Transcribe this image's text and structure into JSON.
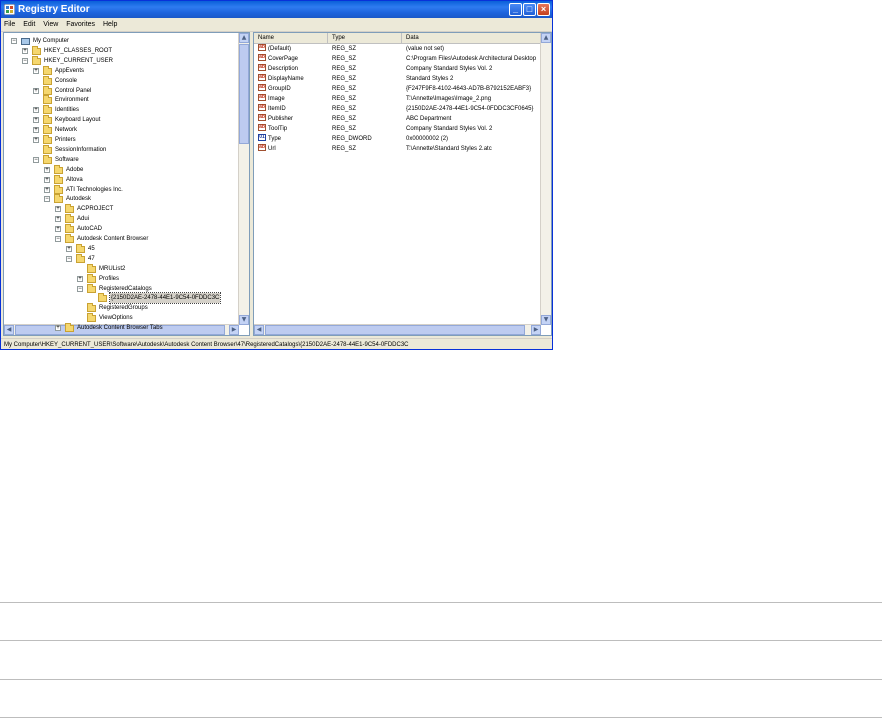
{
  "window": {
    "title": "Registry Editor"
  },
  "menu": [
    "File",
    "Edit",
    "View",
    "Favorites",
    "Help"
  ],
  "tree": [
    {
      "label": "My Computer",
      "indent": 0,
      "expander": "-",
      "icon": "computer"
    },
    {
      "label": "HKEY_CLASSES_ROOT",
      "indent": 1,
      "expander": "+",
      "icon": "folder"
    },
    {
      "label": "HKEY_CURRENT_USER",
      "indent": 1,
      "expander": "-",
      "icon": "folder"
    },
    {
      "label": "AppEvents",
      "indent": 2,
      "expander": "+",
      "icon": "folder"
    },
    {
      "label": "Console",
      "indent": 2,
      "expander": "",
      "icon": "folder"
    },
    {
      "label": "Control Panel",
      "indent": 2,
      "expander": "+",
      "icon": "folder"
    },
    {
      "label": "Environment",
      "indent": 2,
      "expander": "",
      "icon": "folder"
    },
    {
      "label": "Identities",
      "indent": 2,
      "expander": "+",
      "icon": "folder"
    },
    {
      "label": "Keyboard Layout",
      "indent": 2,
      "expander": "+",
      "icon": "folder"
    },
    {
      "label": "Network",
      "indent": 2,
      "expander": "+",
      "icon": "folder"
    },
    {
      "label": "Printers",
      "indent": 2,
      "expander": "+",
      "icon": "folder"
    },
    {
      "label": "SessionInformation",
      "indent": 2,
      "expander": "",
      "icon": "folder"
    },
    {
      "label": "Software",
      "indent": 2,
      "expander": "-",
      "icon": "folder"
    },
    {
      "label": "Adobe",
      "indent": 3,
      "expander": "+",
      "icon": "folder"
    },
    {
      "label": "Altova",
      "indent": 3,
      "expander": "+",
      "icon": "folder"
    },
    {
      "label": "ATI Technologies Inc.",
      "indent": 3,
      "expander": "+",
      "icon": "folder"
    },
    {
      "label": "Autodesk",
      "indent": 3,
      "expander": "-",
      "icon": "folder"
    },
    {
      "label": "ACPROJECT",
      "indent": 4,
      "expander": "+",
      "icon": "folder"
    },
    {
      "label": "Adui",
      "indent": 4,
      "expander": "+",
      "icon": "folder"
    },
    {
      "label": "AutoCAD",
      "indent": 4,
      "expander": "+",
      "icon": "folder"
    },
    {
      "label": "Autodesk Content Browser",
      "indent": 4,
      "expander": "-",
      "icon": "folder"
    },
    {
      "label": "45",
      "indent": 5,
      "expander": "+",
      "icon": "folder"
    },
    {
      "label": "47",
      "indent": 5,
      "expander": "-",
      "icon": "folder"
    },
    {
      "label": "MRUList2",
      "indent": 6,
      "expander": "",
      "icon": "folder"
    },
    {
      "label": "Profiles",
      "indent": 6,
      "expander": "+",
      "icon": "folder"
    },
    {
      "label": "RegisteredCatalogs",
      "indent": 6,
      "expander": "-",
      "icon": "folder"
    },
    {
      "label": "{2150D2AE-2478-44E1-9C54-0FDDC3C",
      "indent": 7,
      "expander": "",
      "icon": "folder",
      "selected": true
    },
    {
      "label": "RegisteredGroups",
      "indent": 6,
      "expander": "",
      "icon": "folder"
    },
    {
      "label": "ViewOptions",
      "indent": 6,
      "expander": "",
      "icon": "folder"
    },
    {
      "label": "Autodesk Content Browser Tabs",
      "indent": 4,
      "expander": "+",
      "icon": "folder"
    }
  ],
  "list": {
    "headers": [
      "Name",
      "Type",
      "Data"
    ],
    "rows": [
      {
        "name": "(Default)",
        "type": "REG_SZ",
        "data": "(value not set)",
        "icon": "ab"
      },
      {
        "name": "CoverPage",
        "type": "REG_SZ",
        "data": "C:\\Program Files\\Autodesk Architectural Desktop",
        "icon": "ab"
      },
      {
        "name": "Description",
        "type": "REG_SZ",
        "data": "Company Standard Styles Vol. 2",
        "icon": "ab"
      },
      {
        "name": "DisplayName",
        "type": "REG_SZ",
        "data": "Standard Styles 2",
        "icon": "ab"
      },
      {
        "name": "GroupID",
        "type": "REG_SZ",
        "data": "{F247F9F8-4102-4643-AD7B-B792152EABF3}",
        "icon": "ab"
      },
      {
        "name": "Image",
        "type": "REG_SZ",
        "data": "T:\\Annette\\Images\\Image_2.png",
        "icon": "ab"
      },
      {
        "name": "ItemID",
        "type": "REG_SZ",
        "data": "{2150D2AE-2478-44E1-9C54-0FDDC3CF0645}",
        "icon": "ab"
      },
      {
        "name": "Publisher",
        "type": "REG_SZ",
        "data": "ABC Department",
        "icon": "ab"
      },
      {
        "name": "ToolTip",
        "type": "REG_SZ",
        "data": "Company Standard Styles Vol. 2",
        "icon": "ab"
      },
      {
        "name": "Type",
        "type": "REG_DWORD",
        "data": "0x00000002 (2)",
        "icon": "dw"
      },
      {
        "name": "Url",
        "type": "REG_SZ",
        "data": "T:\\Annette\\Standard Styles 2.atc",
        "icon": "ab"
      }
    ]
  },
  "statusbar": "My Computer\\HKEY_CURRENT_USER\\Software\\Autodesk\\Autodesk Content Browser\\47\\RegisteredCatalogs\\{2150D2AE-2478-44E1-9C54-0FDDC3C",
  "colors": {
    "titlebar": "#1d63dc",
    "selection": "#d4d0c8"
  },
  "icons": {
    "app": "registry-editor-icon",
    "minimize": "minimize-icon",
    "maximize": "maximize-icon",
    "close": "close-icon"
  }
}
